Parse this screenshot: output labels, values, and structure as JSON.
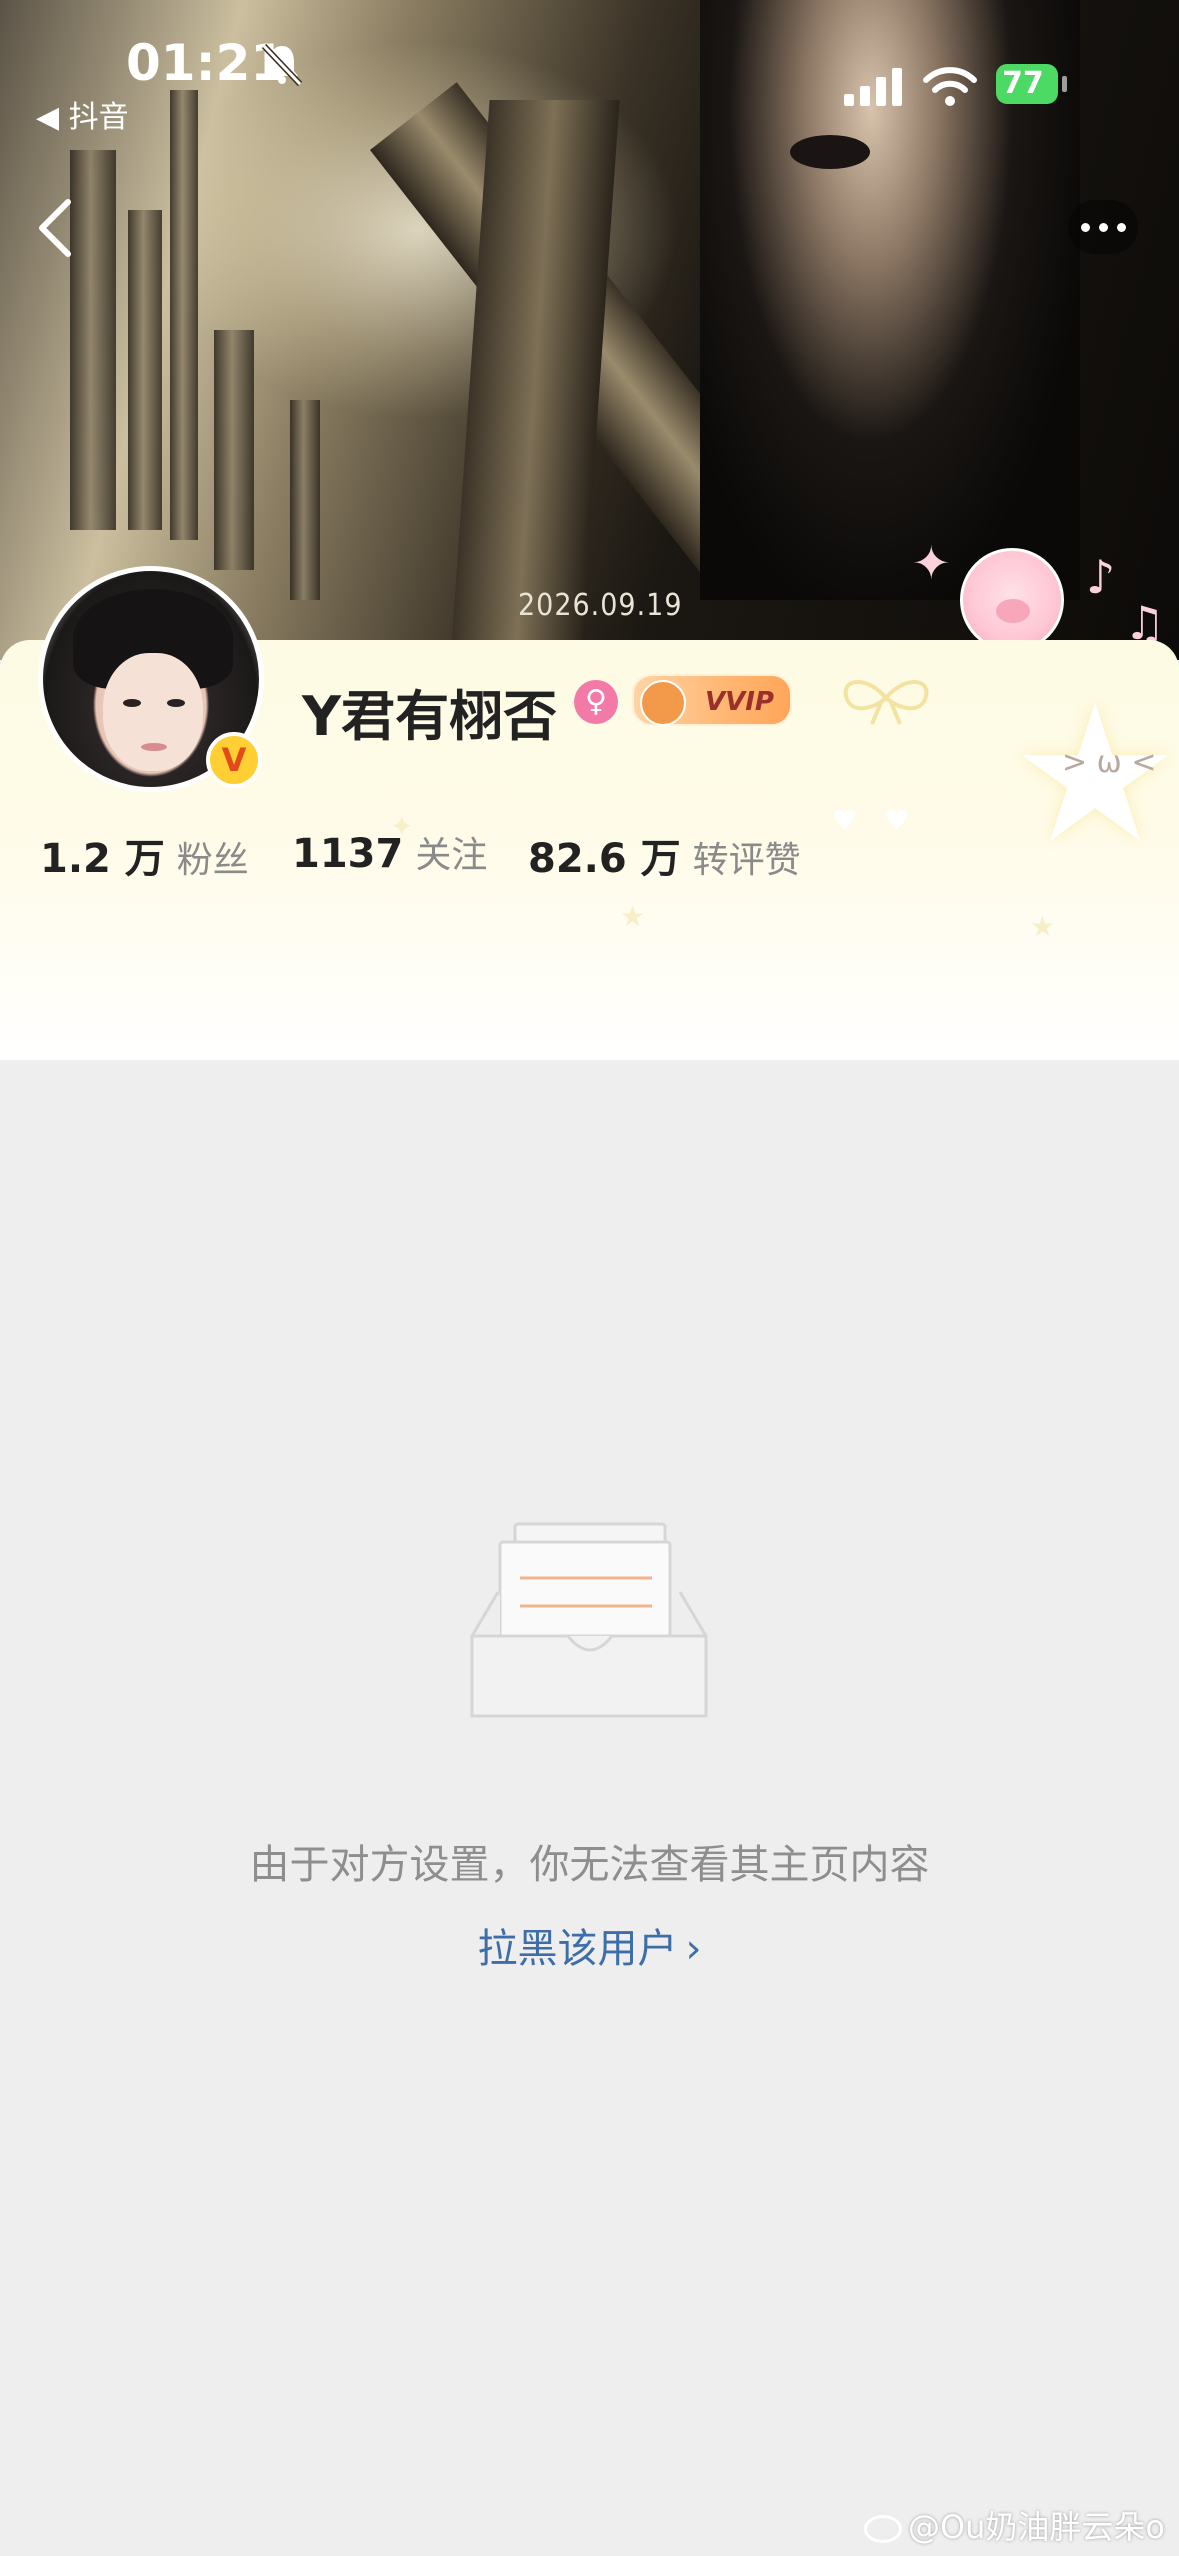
{
  "status_bar": {
    "time": "01:21",
    "back_app": "◀ 抖音",
    "battery": "77"
  },
  "banner": {
    "date": "2026.09.19"
  },
  "profile": {
    "username": "Y君有栩否",
    "gender": "female",
    "vip_badge": "VVIP",
    "verified": "V",
    "stats": [
      {
        "value": "1.2 万",
        "label": "粉丝"
      },
      {
        "value": "1137",
        "label": "关注"
      },
      {
        "value": "82.6 万",
        "label": "转评赞"
      }
    ]
  },
  "sticker": {
    "face": "> ω <"
  },
  "restricted": {
    "message": "由于对方设置，你无法查看其主页内容",
    "block_link": "拉黑该用户"
  },
  "watermark": "@Ou奶油胖云朵o",
  "colors": {
    "link_blue": "#3d6ea8",
    "battery_green": "#4cd964",
    "gender_pink": "#f37aa7",
    "page_bg": "#eeeeee"
  },
  "icons": [
    "bell-off-icon",
    "signal-icon",
    "wifi-icon",
    "back-chevron-icon",
    "more-icon",
    "female-icon",
    "verified-icon",
    "empty-box-icon",
    "weibo-icon"
  ]
}
